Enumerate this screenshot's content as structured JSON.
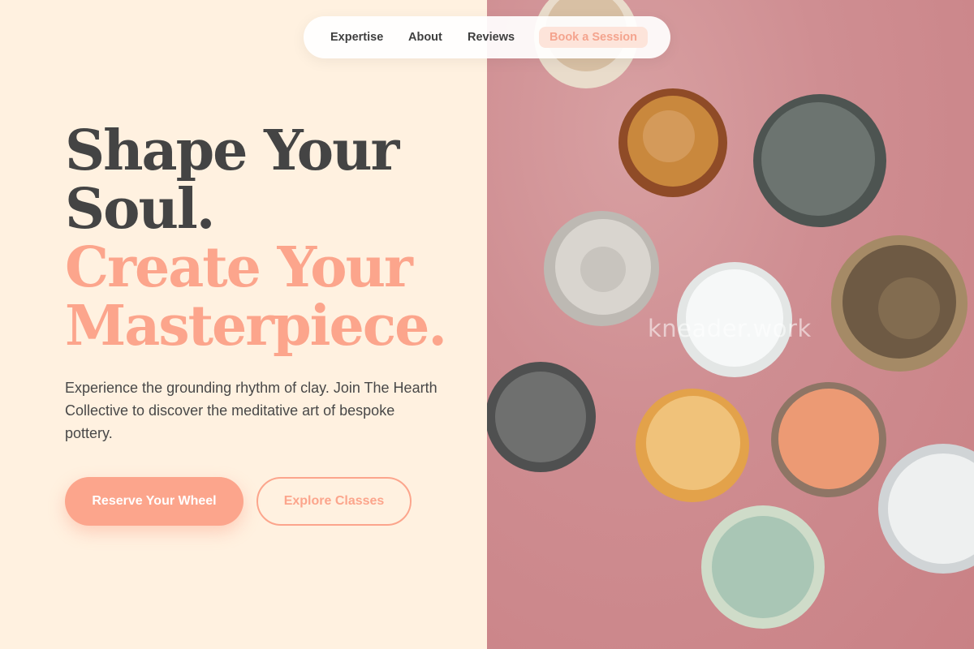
{
  "nav": {
    "items": [
      {
        "label": "Expertise"
      },
      {
        "label": "About"
      },
      {
        "label": "Reviews"
      }
    ],
    "cta_label": "Book a Session"
  },
  "hero": {
    "title_line1": "Shape Your",
    "title_line2": "Soul.",
    "accent_line1": "Create Your",
    "accent_line2": "Masterpiece.",
    "description": "Experience the grounding rhythm of clay. Join The Hearth Collective to discover the meditative art of bespoke pottery.",
    "primary_button": "Reserve Your Wheel",
    "secondary_button": "Explore Classes"
  },
  "image": {
    "watermark": "kneader.work"
  },
  "colors": {
    "accent": "#fca58c",
    "background": "#fff1e0",
    "text_dark": "#444444",
    "photo_backdrop": "#cf8e92"
  }
}
